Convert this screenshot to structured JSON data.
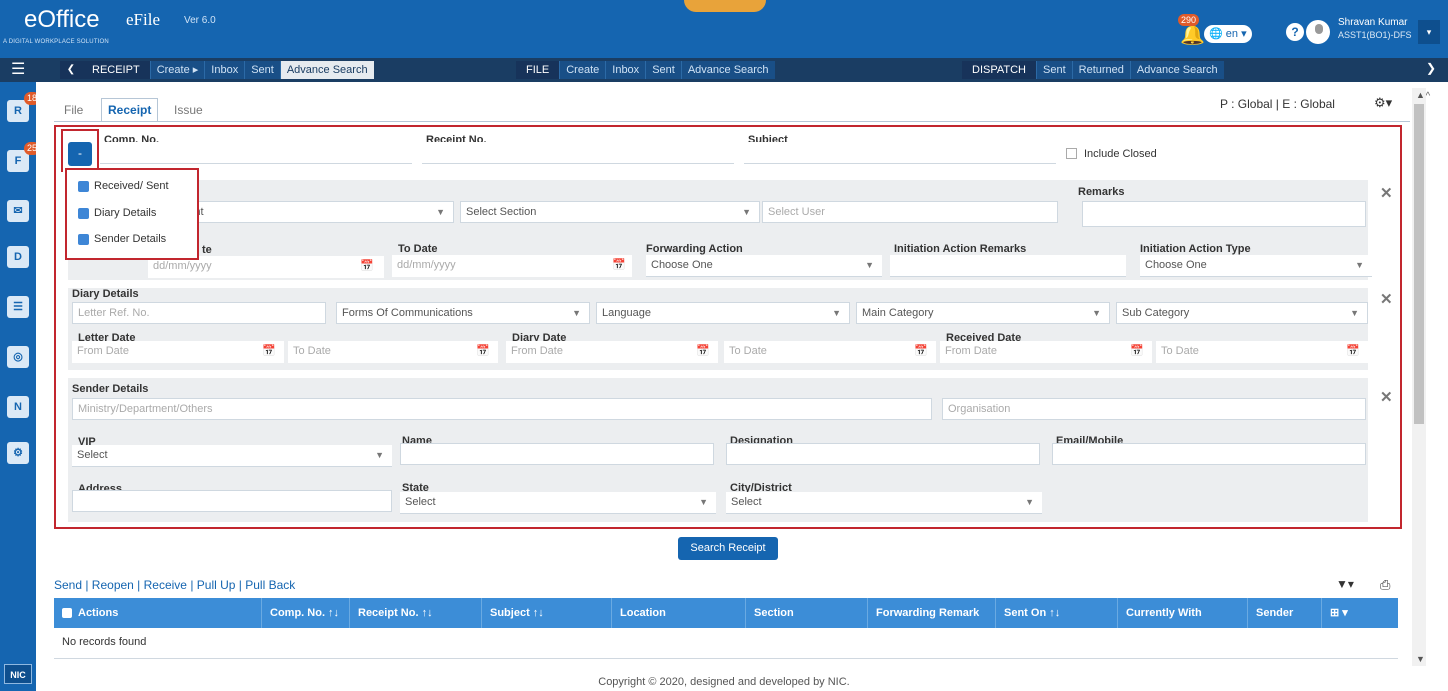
{
  "brand": {
    "logo_prefix": "e",
    "logo_main": "Office",
    "product": "eFile",
    "version": "Ver 6.0",
    "tagline": "A DIGITAL WORKPLACE SOLUTION"
  },
  "header": {
    "notification_count": "290",
    "language": "en",
    "help": "?",
    "user_name": "Shravan Kumar",
    "user_role": "ASST1(BO1)-DFS",
    "dropdown": "▾"
  },
  "nav": {
    "receipt": {
      "title": "RECEIPT",
      "items": [
        "Create ▸",
        "Inbox",
        "Sent",
        "Advance Search"
      ]
    },
    "file": {
      "title": "FILE",
      "items": [
        "Create",
        "Inbox",
        "Sent",
        "Advance Search"
      ]
    },
    "dispatch": {
      "title": "DISPATCH",
      "items": [
        "Sent",
        "Returned",
        "Advance Search"
      ]
    }
  },
  "sidebar": {
    "items": [
      {
        "icon": "receipt-icon",
        "label": "R",
        "badge": "18"
      },
      {
        "icon": "file-icon",
        "label": "F",
        "badge": "25"
      },
      {
        "icon": "mail-icon",
        "label": "✉"
      },
      {
        "icon": "dispatch-icon",
        "label": "D"
      },
      {
        "icon": "directory-icon",
        "label": "☰"
      },
      {
        "icon": "profile-icon",
        "label": "◎"
      },
      {
        "icon": "task-icon",
        "label": "N"
      },
      {
        "icon": "settings-user-icon",
        "label": "⚙"
      }
    ],
    "footer": "NIC"
  },
  "tabs": [
    "File",
    "Receipt",
    "Issue"
  ],
  "scope": {
    "text": "P : Global  |  E : Global"
  },
  "form": {
    "comp_no": "Comp. No.",
    "receipt_no": "Receipt No.",
    "subject": "Subject",
    "include_closed": "Include Closed",
    "toggle": "-",
    "popup": [
      "Received/ Sent",
      "Diary Details",
      "Sender Details"
    ],
    "received": {
      "dept": "epartment",
      "section": "Select Section",
      "user": "Select User",
      "remarks": "Remarks",
      "from_date_lbl": "te",
      "from_date_ph": "dd/mm/yyyy",
      "to_date_lbl": "To Date",
      "to_date_ph": "dd/mm/yyyy",
      "fwd_action": "Forwarding Action",
      "fwd_action_val": "Choose One",
      "init_remarks": "Initiation Action Remarks",
      "init_type": "Initiation Action Type",
      "init_type_val": "Choose One"
    },
    "diary": {
      "title": "Diary Details",
      "letter_ref": "Letter Ref. No.",
      "forms": "Forms Of Communications",
      "language": "Language",
      "main_cat": "Main Category",
      "sub_cat": "Sub Category",
      "letter_date": "Letter Date",
      "diary_date": "Diary Date",
      "received_date": "Received Date",
      "from_date": "From Date",
      "to_date": "To Date"
    },
    "sender": {
      "title": "Sender Details",
      "ministry": "Ministry/Department/Others",
      "organisation": "Organisation",
      "vip": "VIP",
      "vip_val": "Select",
      "name": "Name",
      "designation": "Designation",
      "email": "Email/Mobile",
      "address": "Address",
      "state": "State",
      "state_val": "Select",
      "city": "City/District",
      "city_val": "Select"
    }
  },
  "search_button": "Search Receipt",
  "actions": "Send | Reopen | Receive | Pull Up | Pull Back",
  "grid": {
    "columns": [
      "Actions",
      "Comp. No. ↑↓",
      "Receipt No. ↑↓",
      "Subject ↑↓",
      "Location",
      "Section",
      "Forwarding Remark",
      "Sent On ↑↓",
      "Currently With",
      "Sender"
    ],
    "empty": "No records found"
  },
  "footer": "Copyright © 2020, designed and developed by NIC."
}
